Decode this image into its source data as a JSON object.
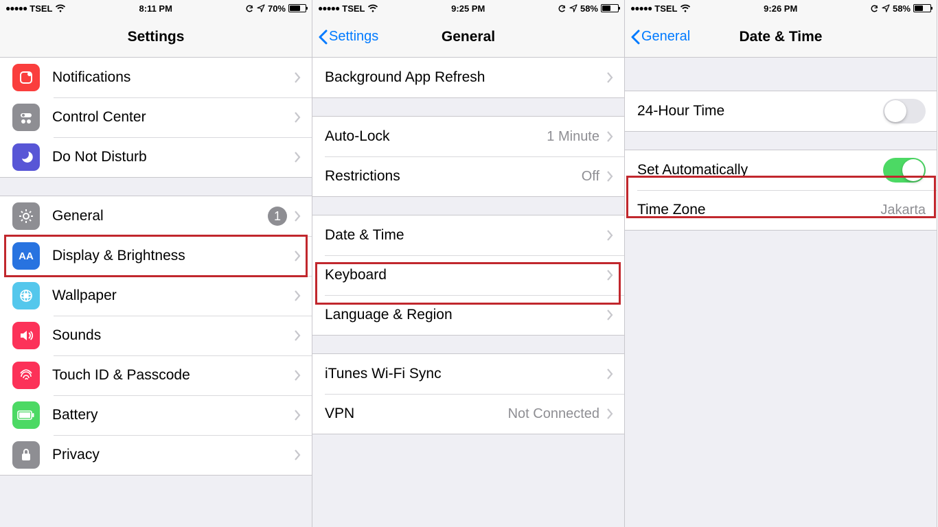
{
  "panel1": {
    "status": {
      "carrier": "TSEL",
      "time": "8:11 PM",
      "battery_pct": "70%",
      "battery_fill": "70%"
    },
    "nav": {
      "title": "Settings"
    },
    "groups": [
      {
        "rows": [
          {
            "icon": "notif",
            "label": "Notifications"
          },
          {
            "icon": "cc",
            "label": "Control Center"
          },
          {
            "icon": "dnd",
            "label": "Do Not Disturb"
          }
        ]
      },
      {
        "rows": [
          {
            "icon": "gen",
            "label": "General",
            "badge": "1"
          },
          {
            "icon": "disp",
            "label": "Display & Brightness"
          },
          {
            "icon": "wall",
            "label": "Wallpaper"
          },
          {
            "icon": "sound",
            "label": "Sounds"
          },
          {
            "icon": "touch",
            "label": "Touch ID & Passcode"
          },
          {
            "icon": "batt",
            "label": "Battery"
          },
          {
            "icon": "priv",
            "label": "Privacy"
          }
        ]
      }
    ]
  },
  "panel2": {
    "status": {
      "carrier": "TSEL",
      "time": "9:25 PM",
      "battery_pct": "58%",
      "battery_fill": "58%"
    },
    "nav": {
      "back": "Settings",
      "title": "General"
    },
    "groups": [
      {
        "rows": [
          {
            "label": "Background App Refresh"
          }
        ]
      },
      {
        "rows": [
          {
            "label": "Auto-Lock",
            "value": "1 Minute"
          },
          {
            "label": "Restrictions",
            "value": "Off"
          }
        ]
      },
      {
        "rows": [
          {
            "label": "Date & Time"
          },
          {
            "label": "Keyboard"
          },
          {
            "label": "Language & Region"
          }
        ]
      },
      {
        "rows": [
          {
            "label": "iTunes Wi-Fi Sync"
          },
          {
            "label": "VPN",
            "value": "Not Connected"
          }
        ]
      }
    ]
  },
  "panel3": {
    "status": {
      "carrier": "TSEL",
      "time": "9:26 PM",
      "battery_pct": "58%",
      "battery_fill": "58%"
    },
    "nav": {
      "back": "General",
      "title": "Date & Time"
    },
    "rows": {
      "r24h": "24-Hour Time",
      "setauto": "Set Automatically",
      "tz_label": "Time Zone",
      "tz_value": "Jakarta"
    }
  }
}
